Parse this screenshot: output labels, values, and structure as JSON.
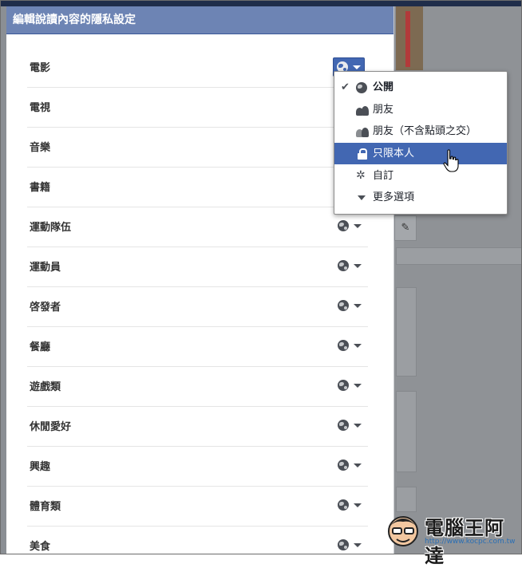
{
  "dialog": {
    "title": "編輯說讀內容的隱私設定"
  },
  "categories": [
    {
      "label": "電影",
      "privacy": "public",
      "active": true
    },
    {
      "label": "電視",
      "privacy": "public"
    },
    {
      "label": "音樂",
      "privacy": "public"
    },
    {
      "label": "書籍",
      "privacy": "public"
    },
    {
      "label": "運動隊伍",
      "privacy": "public"
    },
    {
      "label": "運動員",
      "privacy": "public"
    },
    {
      "label": "啓發者",
      "privacy": "public"
    },
    {
      "label": "餐廳",
      "privacy": "public"
    },
    {
      "label": "遊戲類",
      "privacy": "public"
    },
    {
      "label": "休閒愛好",
      "privacy": "public"
    },
    {
      "label": "興趣",
      "privacy": "public"
    },
    {
      "label": "體育類",
      "privacy": "public"
    },
    {
      "label": "美食",
      "privacy": "public"
    }
  ],
  "privacy_menu": {
    "items": [
      {
        "label": "公開",
        "icon": "globe-icon",
        "checked": true,
        "bold": true
      },
      {
        "label": "朋友",
        "icon": "friends-icon"
      },
      {
        "label": "朋友（不含點頭之交）",
        "icon": "friends-except-icon"
      },
      {
        "label": "只限本人",
        "icon": "lock-icon",
        "highlighted": true
      },
      {
        "label": "自訂",
        "icon": "gear-icon"
      },
      {
        "label": "更多選項",
        "icon": "caret-down-icon"
      }
    ]
  },
  "watermark": {
    "text": "電腦王阿達",
    "url": "http://www.kocpc.com.tw"
  },
  "colors": {
    "header_bg": "#6d84b4",
    "accent": "#4267b2",
    "dim_bg": "#8b8f94"
  }
}
